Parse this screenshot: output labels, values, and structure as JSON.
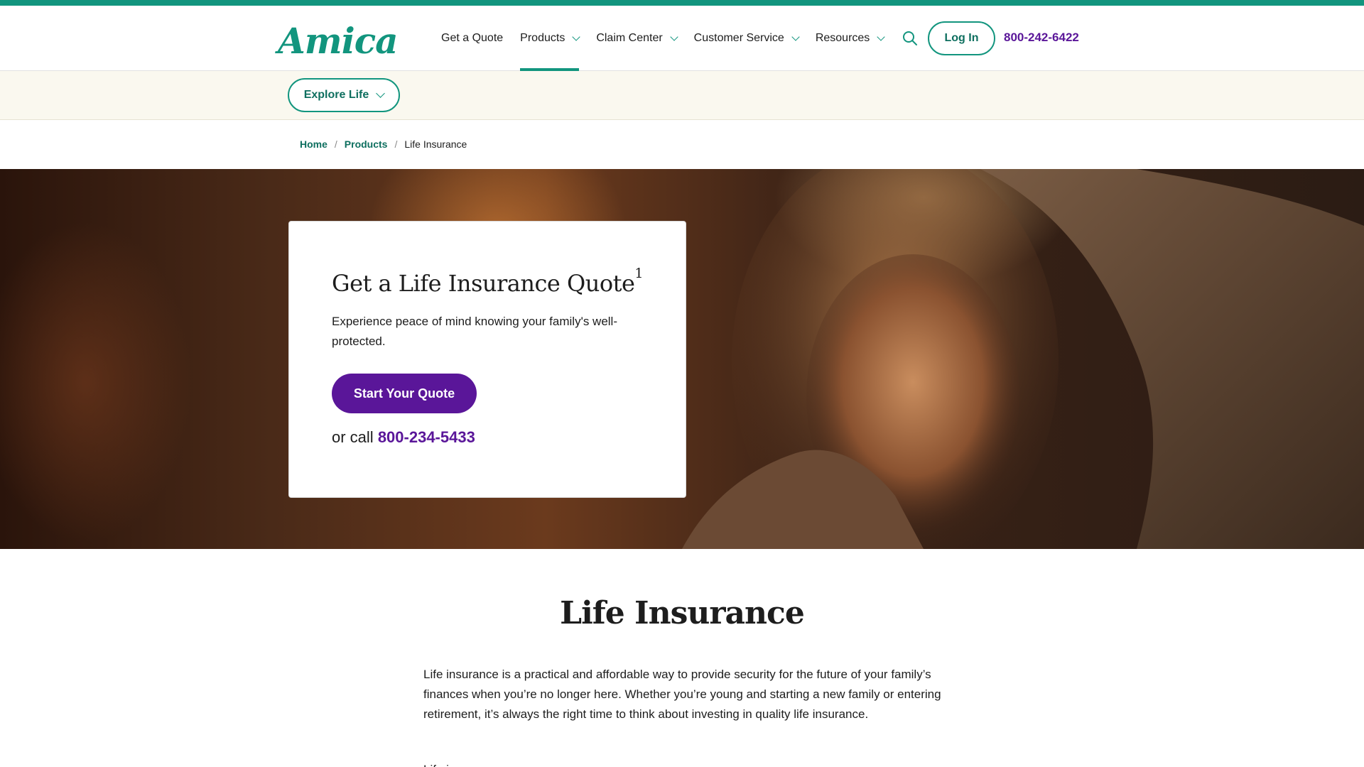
{
  "brand": {
    "logo_text": "Amica",
    "accent": "#12957e",
    "purple": "#5a1699"
  },
  "nav": {
    "items": [
      {
        "label": "Get a Quote",
        "has_dropdown": false,
        "active": false
      },
      {
        "label": "Products",
        "has_dropdown": true,
        "active": true
      },
      {
        "label": "Claim Center",
        "has_dropdown": true,
        "active": false
      },
      {
        "label": "Customer Service",
        "has_dropdown": true,
        "active": false
      },
      {
        "label": "Resources",
        "has_dropdown": true,
        "active": false
      }
    ],
    "search_icon": "search-icon",
    "login_label": "Log In",
    "phone": "800-242-6422"
  },
  "subnav": {
    "explore_label": "Explore Life"
  },
  "breadcrumb": {
    "home": "Home",
    "products": "Products",
    "current": "Life Insurance",
    "separator": "/"
  },
  "hero": {
    "card": {
      "title": "Get a Life Insurance Quote",
      "title_sup": "1",
      "description": "Experience peace of mind knowing your family's well-protected.",
      "cta_label": "Start Your Quote",
      "or_call": "or call",
      "phone": "800-234-5433"
    }
  },
  "main": {
    "title": "Life Insurance",
    "paragraph1": "Life insurance is a practical and affordable way to provide security for the future of your family’s finances when you’re no longer here. Whether you’re young and starting a new family or entering retirement, it’s always the right time to think about investing in quality life insurance.",
    "paragraph2": "Life insurance"
  }
}
